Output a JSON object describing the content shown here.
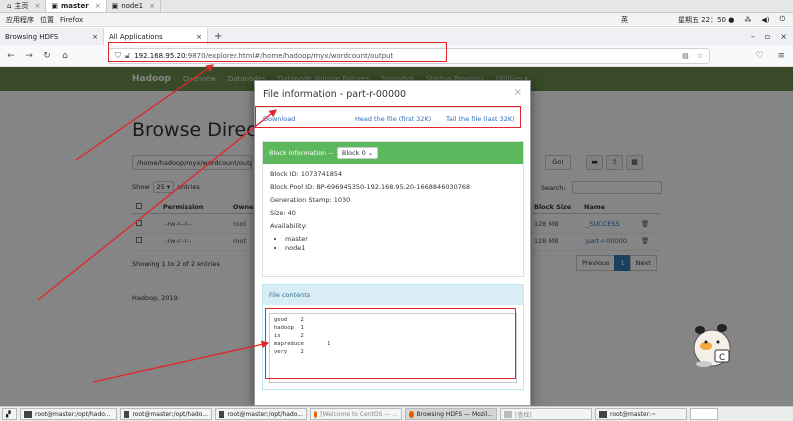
{
  "vm_tabs": [
    {
      "label": "主页",
      "icon": "home-icon"
    },
    {
      "label": "master",
      "icon": "vm-icon"
    },
    {
      "label": "node1",
      "icon": "vm-icon"
    }
  ],
  "gnome": {
    "applications": "应用程序",
    "places": "位置",
    "firefox": "Firefox",
    "input_method": "英",
    "datetime": "星期五 22：50 ●"
  },
  "browser_tabs": [
    "Browsing HDFS",
    "All Applications"
  ],
  "url": {
    "host": "192.168.95.20",
    "rest": ":9870/explorer.html#/home/hadoop/myx/wordcount/output"
  },
  "hadoop_nav": {
    "brand": "Hadoop",
    "items": [
      "Overview",
      "Datanodes",
      "Datanode Volume Failures",
      "Snapshot",
      "Startup Progress",
      "Utilities ▾"
    ]
  },
  "browse": {
    "title": "Browse Directory",
    "path": "/home/hadoop/myx/wordcount/output",
    "go": "Go!",
    "show": "Show",
    "entries_count": "25",
    "entries_word": "entries",
    "search": "Search:",
    "columns": [
      "Permission",
      "Owner",
      "Block Size",
      "Name"
    ],
    "rows": [
      {
        "perm": "-rw-r--r--",
        "owner": "root",
        "block": "128 MB",
        "name": "_SUCCESS"
      },
      {
        "perm": "-rw-r--r--",
        "owner": "root",
        "block": "128 MB",
        "name": "part-r-00000"
      }
    ],
    "showing": "Showing 1 to 2 of 2 entries",
    "previous": "Previous",
    "page": "1",
    "next": "Next",
    "footer": "Hadoop, 2019."
  },
  "modal": {
    "title": "File information - part-r-00000",
    "close": "×",
    "download": "Download",
    "head": "Head the file (first 32K)",
    "tail": "Tail the file (last 32K)",
    "block_label": "Block information --",
    "block_select": "Block 0",
    "block_id": "Block ID: 1073741854",
    "pool_id": "Block Pool ID: BP-696945350-192.168.95.20-1668846030768",
    "gen_stamp": "Generation Stamp: 1030",
    "size": "Size: 40",
    "availability": "Availability:",
    "nodes": [
      "master",
      "node1"
    ],
    "contents_label": "File contents",
    "contents": "good\t2\nhadoop\t1\nis\t2\nmapreduce\t1\nvery\t2"
  },
  "taskbar": [
    {
      "label": "root@master:/opt/hado...",
      "icon": "terminal-icon"
    },
    {
      "label": "root@master:/opt/hado...",
      "icon": "terminal-icon"
    },
    {
      "label": "root@master:/opt/hado...",
      "icon": "terminal-icon"
    },
    {
      "label": "[Welcome to CentOS — ...",
      "icon": "firefox-icon"
    },
    {
      "label": "Browsing HDFS — Mozil...",
      "icon": "firefox-icon"
    },
    {
      "label": "[查找]",
      "icon": "search-icon"
    },
    {
      "label": "root@master:~",
      "icon": "terminal-icon"
    }
  ],
  "colors": {
    "hadoop_green": "#6d8f4e",
    "panel_green": "#5cb85c",
    "link_blue": "#2a6ebb",
    "annotation_red": "#e0262b"
  }
}
